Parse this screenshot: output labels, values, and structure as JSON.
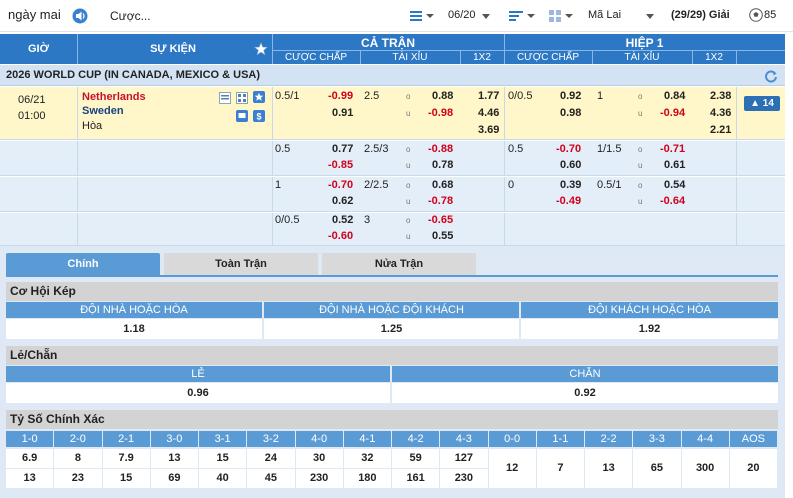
{
  "topbar": {
    "day_label": "ngày mai",
    "odds_select": "Cược...",
    "date_select": "06/20",
    "language_select": "Mã Lai",
    "tournament_count": "(29/29) Giải",
    "live_count": "85"
  },
  "header": {
    "time": "GIỜ",
    "event": "SỰ KIỆN",
    "full_match": "CẢ TRẬN",
    "first_half": "HIỆP 1",
    "handicap": "CƯỢC CHẤP",
    "over_under": "TÀI XỈU",
    "one_x_two": "1X2",
    "handicap_h1": "CƯỢC CHẤP",
    "over_under_h1": "TÀI XỈU",
    "one_x_two_h1": "1X2"
  },
  "league": {
    "name": "2026 WORLD CUP (IN CANADA, MEXICO & USA)"
  },
  "match": {
    "date": "06/21",
    "time": "01:00",
    "home": "Netherlands",
    "away": "Sweden",
    "draw": "Hòa",
    "more": "14"
  },
  "odds_rows": [
    {
      "ft_hdp_line": "0.5/1",
      "ft_hdp_home": "-0.99",
      "ft_hdp_away": "0.91",
      "ft_ou_line": "2.5",
      "ft_ou_o_tag": "o",
      "ft_ou_u_tag": "u",
      "ft_ou_over": "0.88",
      "ft_ou_under": "-0.98",
      "ft_1x2_home": "1.77",
      "ft_1x2_away": "4.46",
      "ft_1x2_draw": "3.69",
      "h1_hdp_line": "0/0.5",
      "h1_hdp_home": "0.92",
      "h1_hdp_away": "0.98",
      "h1_ou_line": "1",
      "h1_ou_o_tag": "o",
      "h1_ou_u_tag": "u",
      "h1_ou_over": "0.84",
      "h1_ou_under": "-0.94",
      "h1_1x2_home": "2.38",
      "h1_1x2_away": "4.36",
      "h1_1x2_draw": "2.21"
    },
    {
      "ft_hdp_line": "0.5",
      "ft_hdp_home": "0.77",
      "ft_hdp_away": "-0.85",
      "ft_ou_line": "2.5/3",
      "ft_ou_o_tag": "o",
      "ft_ou_u_tag": "u",
      "ft_ou_over": "-0.88",
      "ft_ou_under": "0.78",
      "h1_hdp_line": "0.5",
      "h1_hdp_home": "-0.70",
      "h1_hdp_away": "0.60",
      "h1_ou_line": "1/1.5",
      "h1_ou_o_tag": "o",
      "h1_ou_u_tag": "u",
      "h1_ou_over": "-0.71",
      "h1_ou_under": "0.61"
    },
    {
      "ft_hdp_line": "1",
      "ft_hdp_home": "-0.70",
      "ft_hdp_away": "0.62",
      "ft_ou_line": "2/2.5",
      "ft_ou_o_tag": "o",
      "ft_ou_u_tag": "u",
      "ft_ou_over": "0.68",
      "ft_ou_under": "-0.78",
      "h1_hdp_line": "0",
      "h1_hdp_home": "0.39",
      "h1_hdp_away": "-0.49",
      "h1_ou_line": "0.5/1",
      "h1_ou_o_tag": "o",
      "h1_ou_u_tag": "u",
      "h1_ou_over": "0.54",
      "h1_ou_under": "-0.64"
    },
    {
      "ft_hdp_line": "0/0.5",
      "ft_hdp_home": "0.52",
      "ft_hdp_away": "-0.60",
      "ft_ou_line": "3",
      "ft_ou_o_tag": "o",
      "ft_ou_u_tag": "u",
      "ft_ou_over": "-0.65",
      "ft_ou_under": "0.55"
    }
  ],
  "tabs": [
    "Chính",
    "Toàn Trận",
    "Nửa Trận"
  ],
  "double_chance": {
    "title": "Cơ Hội Kép",
    "heads": [
      "ĐỘI NHÀ HOẶC HÒA",
      "ĐỘI NHÀ HOẶC ĐỘI KHÁCH",
      "ĐỘI KHÁCH HOẶC HÒA"
    ],
    "values": [
      "1.18",
      "1.25",
      "1.92"
    ]
  },
  "odd_even": {
    "title": "Lẻ/Chẵn",
    "heads": [
      "LẺ",
      "CHẴN"
    ],
    "values": [
      "0.96",
      "0.92"
    ]
  },
  "correct_score": {
    "title": "Tỷ Số Chính Xác",
    "heads": [
      "1-0",
      "2-0",
      "2-1",
      "3-0",
      "3-1",
      "3-2",
      "4-0",
      "4-1",
      "4-2",
      "4-3",
      "0-0",
      "1-1",
      "2-2",
      "3-3",
      "4-4",
      "AOS"
    ],
    "home_win": [
      "6.9",
      "8",
      "7.9",
      "13",
      "15",
      "24",
      "30",
      "32",
      "59",
      "127"
    ],
    "away_win": [
      "13",
      "23",
      "15",
      "69",
      "40",
      "45",
      "230",
      "180",
      "161",
      "230"
    ],
    "draw": [
      "12",
      "7",
      "13",
      "65",
      "300",
      "20"
    ]
  },
  "colors": {
    "header": "#2d78c4",
    "accent": "#5b9bd5",
    "highlight_row": "#fff7c9",
    "negative": "#d0021b"
  }
}
